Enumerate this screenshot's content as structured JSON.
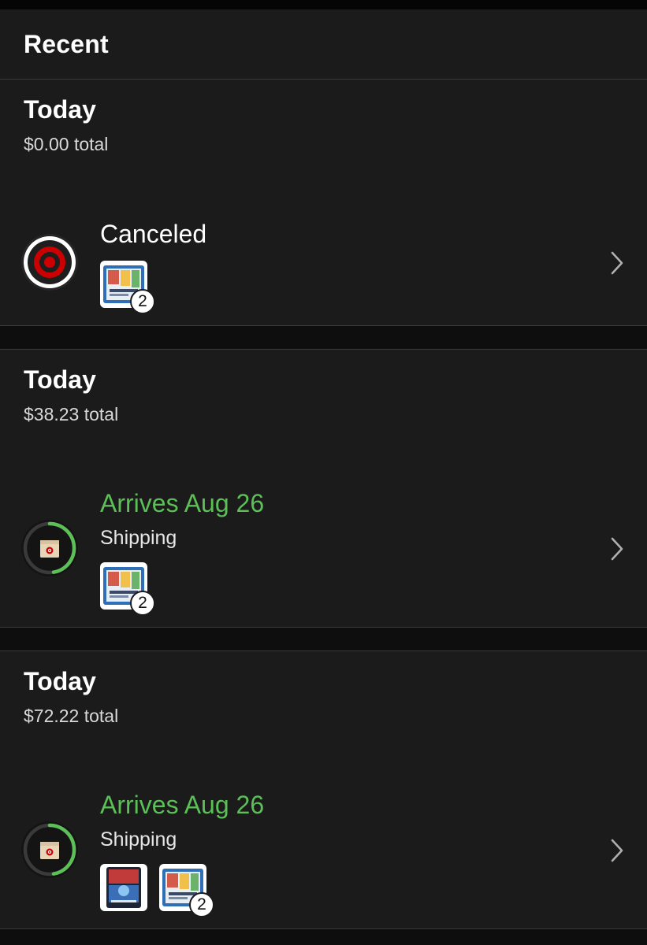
{
  "header": {
    "title": "Recent"
  },
  "orders": [
    {
      "date": "Today",
      "total": "$0.00 total",
      "status": "Canceled",
      "status_color": "#ffffff",
      "substatus": "",
      "items": [
        {
          "icon": "pokemon-collection-box-thumbnail",
          "quantity": "2"
        }
      ]
    },
    {
      "date": "Today",
      "total": "$38.23 total",
      "status": "Arrives Aug 26",
      "status_color": "#5cbf57",
      "substatus": "Shipping",
      "items": [
        {
          "icon": "pokemon-collection-box-thumbnail",
          "quantity": "2"
        }
      ]
    },
    {
      "date": "Today",
      "total": "$72.22 total",
      "status": "Arrives Aug 26",
      "status_color": "#5cbf57",
      "substatus": "Shipping",
      "items": [
        {
          "icon": "pokemon-tin-thumbnail",
          "quantity": ""
        },
        {
          "icon": "pokemon-collection-box-thumbnail",
          "quantity": "2"
        }
      ]
    }
  ],
  "colors": {
    "accent_green": "#5cbf57",
    "target_red": "#cc0000",
    "background": "#1b1b1b"
  }
}
